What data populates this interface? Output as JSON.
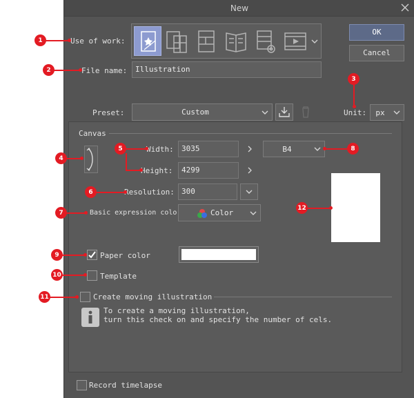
{
  "window": {
    "title": "New"
  },
  "use_of_work": {
    "label": "Use of work:",
    "options": [
      "illustration-icon",
      "comic-icon",
      "comic-page-icon",
      "book-icon",
      "custom-settings-icon",
      "animation-icon"
    ],
    "selected": 0
  },
  "actions": {
    "ok_label": "OK",
    "cancel_label": "Cancel"
  },
  "file_name": {
    "label": "File name:",
    "value": "Illustration"
  },
  "preset": {
    "label": "Preset:",
    "value": "Custom"
  },
  "unit": {
    "label": "Unit:",
    "value": "px"
  },
  "canvas": {
    "section_label": "Canvas",
    "width_label": "Width:",
    "width_value": "3035",
    "height_label": "Height:",
    "height_value": "4299",
    "size_preset": "B4",
    "resolution_label": "Resolution:",
    "resolution_value": "300",
    "expression_label": "Basic expression color:",
    "expression_value": "Color"
  },
  "paper_color": {
    "label": "Paper color",
    "checked": true,
    "color": "#ffffff"
  },
  "template": {
    "label": "Template",
    "checked": false
  },
  "moving": {
    "label": "Create moving illustration",
    "checked": false,
    "info_line1": "To create a moving illustration,",
    "info_line2": "turn this check on and specify the number of cels."
  },
  "timelapse": {
    "label": "Record timelapse",
    "checked": false
  },
  "annotations": [
    "1",
    "2",
    "3",
    "4",
    "5",
    "6",
    "7",
    "8",
    "9",
    "10",
    "11",
    "12"
  ],
  "colors": {
    "dialog_bg": "#545454",
    "accent": "#8d9bd0",
    "annotation": "#e31b23"
  }
}
